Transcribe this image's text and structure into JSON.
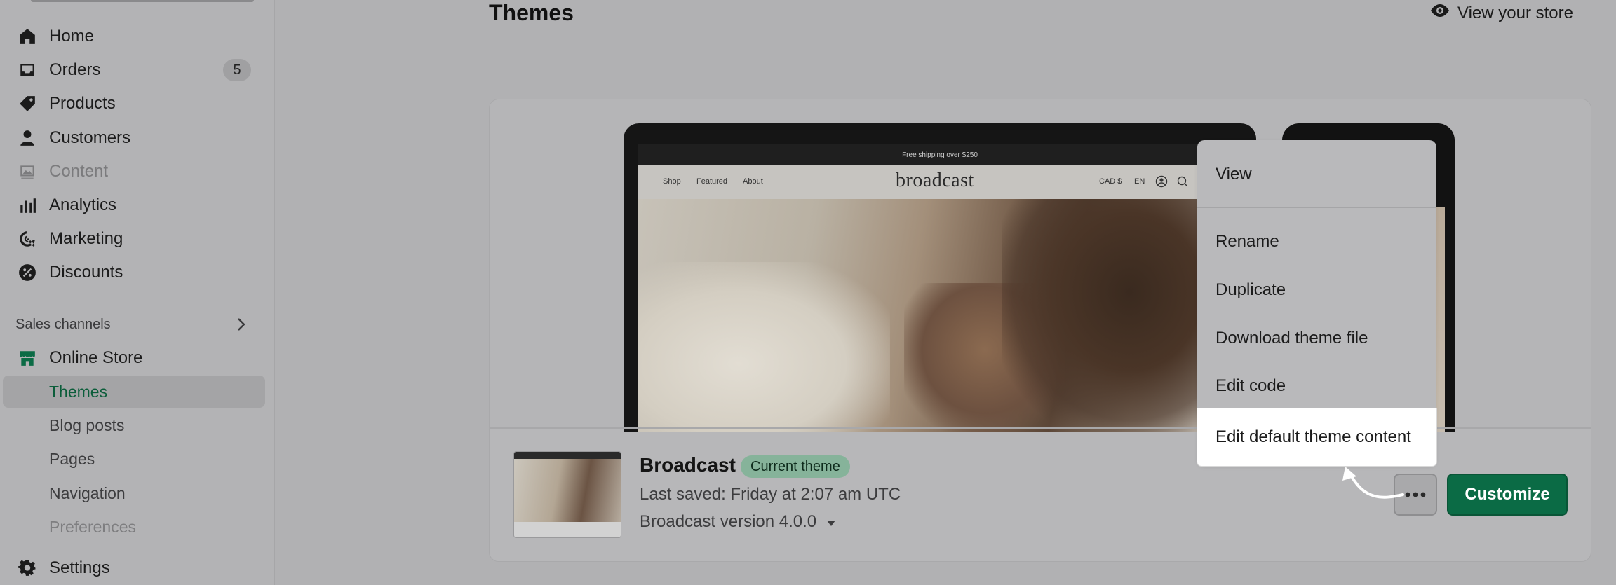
{
  "sidebar": {
    "items": [
      {
        "label": "Home",
        "icon": "home-icon"
      },
      {
        "label": "Orders",
        "icon": "inbox-icon",
        "badge": "5"
      },
      {
        "label": "Products",
        "icon": "tag-icon"
      },
      {
        "label": "Customers",
        "icon": "person-icon"
      },
      {
        "label": "Content",
        "icon": "image-icon"
      },
      {
        "label": "Analytics",
        "icon": "bar-chart-icon"
      },
      {
        "label": "Marketing",
        "icon": "target-icon"
      },
      {
        "label": "Discounts",
        "icon": "discount-icon"
      }
    ],
    "sales_channels_title": "Sales channels",
    "online_store": "Online Store",
    "sub_items": [
      "Themes",
      "Blog posts",
      "Pages",
      "Navigation",
      "Preferences"
    ],
    "settings": "Settings"
  },
  "header": {
    "title": "Themes",
    "view_store": "View your store"
  },
  "preview": {
    "announcement": "Free shipping over $250",
    "nav_links": [
      "Shop",
      "Featured",
      "About"
    ],
    "brand": "broadcast",
    "right_links": [
      "CAD $",
      "EN"
    ]
  },
  "theme": {
    "name": "Broadcast",
    "badge": "Current theme",
    "last_saved": "Last saved: Friday at 2:07 am UTC",
    "version": "Broadcast version 4.0.0",
    "customize_label": "Customize"
  },
  "menu": {
    "items": [
      "View",
      "Rename",
      "Duplicate",
      "Download theme file",
      "Edit code",
      "Edit default theme content"
    ]
  },
  "colors": {
    "accent": "#0b6b45",
    "active_link": "#0b5d3a",
    "badge_bg": "#86b39a"
  }
}
